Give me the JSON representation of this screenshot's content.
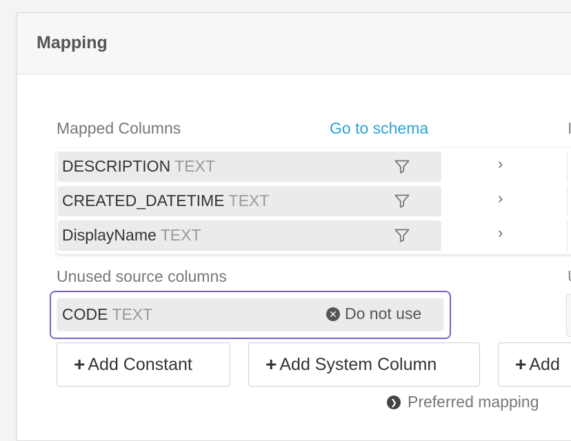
{
  "panel": {
    "title": "Mapping"
  },
  "mapped": {
    "label": "Mapped Columns",
    "schema_link": "Go to schema",
    "rows": [
      {
        "name": "DESCRIPTION",
        "type": "TEXT"
      },
      {
        "name": "CREATED_DATETIME",
        "type": "TEXT"
      },
      {
        "name": "DisplayName",
        "type": "TEXT"
      }
    ],
    "chevron": "›"
  },
  "unused": {
    "label": "Unused source columns",
    "rows": [
      {
        "name": "CODE",
        "type": "TEXT",
        "action": "Do not use"
      }
    ]
  },
  "buttons": {
    "add_constant": "Add Constant",
    "add_system_column": "Add System Column",
    "add_partial": "Add"
  },
  "preferred_mapping": "Preferred mapping",
  "right_edge": {
    "top_glyph": "I",
    "mid_glyph": "U"
  },
  "icons": {
    "filter": "filter-icon",
    "remove": "x-circle-icon",
    "preferred": "chevron-right-circle-icon"
  }
}
